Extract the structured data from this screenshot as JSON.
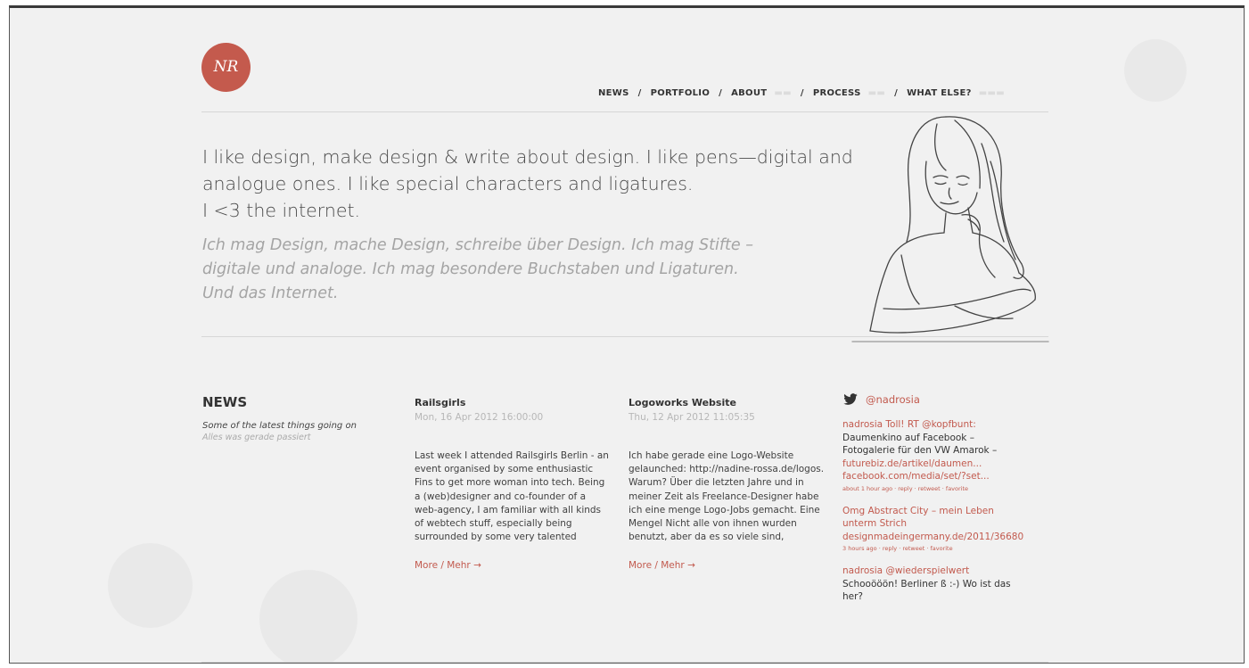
{
  "brand": {
    "logo_text": "NR"
  },
  "nav": {
    "items": [
      {
        "label": "NEWS"
      },
      {
        "label": "PORTFOLIO"
      },
      {
        "label": "ABOUT"
      },
      {
        "label": "PROCESS"
      },
      {
        "label": "WHAT ELSE?"
      }
    ],
    "separator": "/"
  },
  "intro": {
    "english_lines": [
      "I like design, make design & write about design. I like pens—digital and",
      "analogue ones. I like special characters and ligatures.",
      "I <3 the internet."
    ],
    "german_lines": [
      "Ich mag Design, mache Design, schreibe über Design. Ich mag Stifte –",
      "digitale und analoge. Ich mag besondere Buchstaben und Ligaturen.",
      "Und das Internet."
    ]
  },
  "news": {
    "heading": "NEWS",
    "subtitle_en": "Some of the latest things going on",
    "subtitle_de": "Alles was gerade passiert",
    "posts": [
      {
        "title": "Railsgirls",
        "date": "Mon, 16 Apr 2012 16:00:00",
        "excerpt": "Last week I attended Railsgirls Berlin - an event organised by some enthusiastic Fins to get more woman into tech. Being a (web)designer and co-founder of a web-agency, I am familiar with all kinds of webtech stuff, especially being surrounded by some very talented »code-artists« at",
        "more": "More / Mehr →"
      },
      {
        "title": "Logoworks Website",
        "date": "Thu, 12 Apr 2012 11:05:35",
        "excerpt": "Ich habe gerade eine Logo-Website gelaunched: http://nadine-rossa.de/logos. Warum? Über die letzten Jahre und in meiner Zeit als Freelance-Designer habe ich eine menge Logo-Jobs gemacht. Eine Mengel Nicht alle von ihnen wurden benutzt, aber da es so viele sind,",
        "more": "More / Mehr →"
      }
    ]
  },
  "twitter": {
    "handle": "@nadrosia",
    "tweets": [
      {
        "lines": [
          {
            "text": "nadrosia Toll! RT @kopfbunt:",
            "accent": true
          },
          {
            "text": "Daumenkino auf Facebook –",
            "accent": false
          },
          {
            "text": "Fotogalerie für den VW Amarok –",
            "accent": false
          },
          {
            "text": "futurebiz.de/artikel/daumen...",
            "accent": true
          },
          {
            "text": "facebook.com/media/set/?set...",
            "accent": true
          }
        ],
        "meta": "about 1 hour ago · reply · retweet · favorite"
      },
      {
        "lines": [
          {
            "text": "Omg Abstract City – mein Leben",
            "accent": true
          },
          {
            "text": "unterm Strich",
            "accent": true
          },
          {
            "text": "designmadeingermany.de/2011/36680",
            "accent": true
          }
        ],
        "meta": "3 hours ago · reply · retweet · favorite"
      },
      {
        "lines": [
          {
            "text": "nadrosia @wiederspielwert",
            "accent": true
          },
          {
            "text": "Schooööön! Berliner ß :-) Wo ist das",
            "accent": false
          },
          {
            "text": "her?",
            "accent": false
          }
        ],
        "meta": ""
      }
    ]
  },
  "colors": {
    "accent": "#c45a4d",
    "text": "#333333",
    "muted": "#a4a4a4",
    "background": "#f1f1f1"
  }
}
